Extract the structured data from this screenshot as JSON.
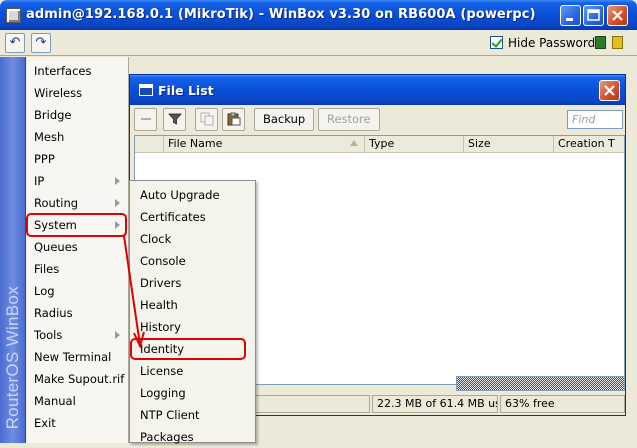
{
  "window": {
    "title": "admin@192.168.0.1 (MikroTik) - WinBox v3.30 on RB600A (powerpc)"
  },
  "toolbar": {
    "undo_glyph": "↶",
    "redo_glyph": "↷",
    "hide_passwords_label": "Hide Passwords",
    "hide_passwords_checked": true
  },
  "brand": {
    "text": "RouterOS WinBox"
  },
  "sidebar": {
    "items": [
      {
        "label": "Interfaces",
        "has_submenu": false
      },
      {
        "label": "Wireless",
        "has_submenu": false
      },
      {
        "label": "Bridge",
        "has_submenu": false
      },
      {
        "label": "Mesh",
        "has_submenu": false
      },
      {
        "label": "PPP",
        "has_submenu": false
      },
      {
        "label": "IP",
        "has_submenu": true
      },
      {
        "label": "Routing",
        "has_submenu": true
      },
      {
        "label": "System",
        "has_submenu": true
      },
      {
        "label": "Queues",
        "has_submenu": false
      },
      {
        "label": "Files",
        "has_submenu": false
      },
      {
        "label": "Log",
        "has_submenu": false
      },
      {
        "label": "Radius",
        "has_submenu": false
      },
      {
        "label": "Tools",
        "has_submenu": true
      },
      {
        "label": "New Terminal",
        "has_submenu": false
      },
      {
        "label": "Make Supout.rif",
        "has_submenu": false
      },
      {
        "label": "Manual",
        "has_submenu": false
      },
      {
        "label": "Exit",
        "has_submenu": false
      }
    ]
  },
  "file_list": {
    "title": "File List",
    "backup_label": "Backup",
    "restore_label": "Restore",
    "find_placeholder": "Find",
    "columns": [
      "File Name",
      "Type",
      "Size",
      "Creation T"
    ],
    "status": {
      "usage": "22.3 MB of 61.4 MB us...",
      "free": "63% free"
    }
  },
  "system_submenu": {
    "items": [
      "Auto Upgrade",
      "Certificates",
      "Clock",
      "Console",
      "Drivers",
      "Health",
      "History",
      "Identity",
      "License",
      "Logging",
      "NTP Client",
      "Packages"
    ]
  },
  "colors": {
    "annotation": "#e00000",
    "title_blue": "#0a4fd6"
  }
}
